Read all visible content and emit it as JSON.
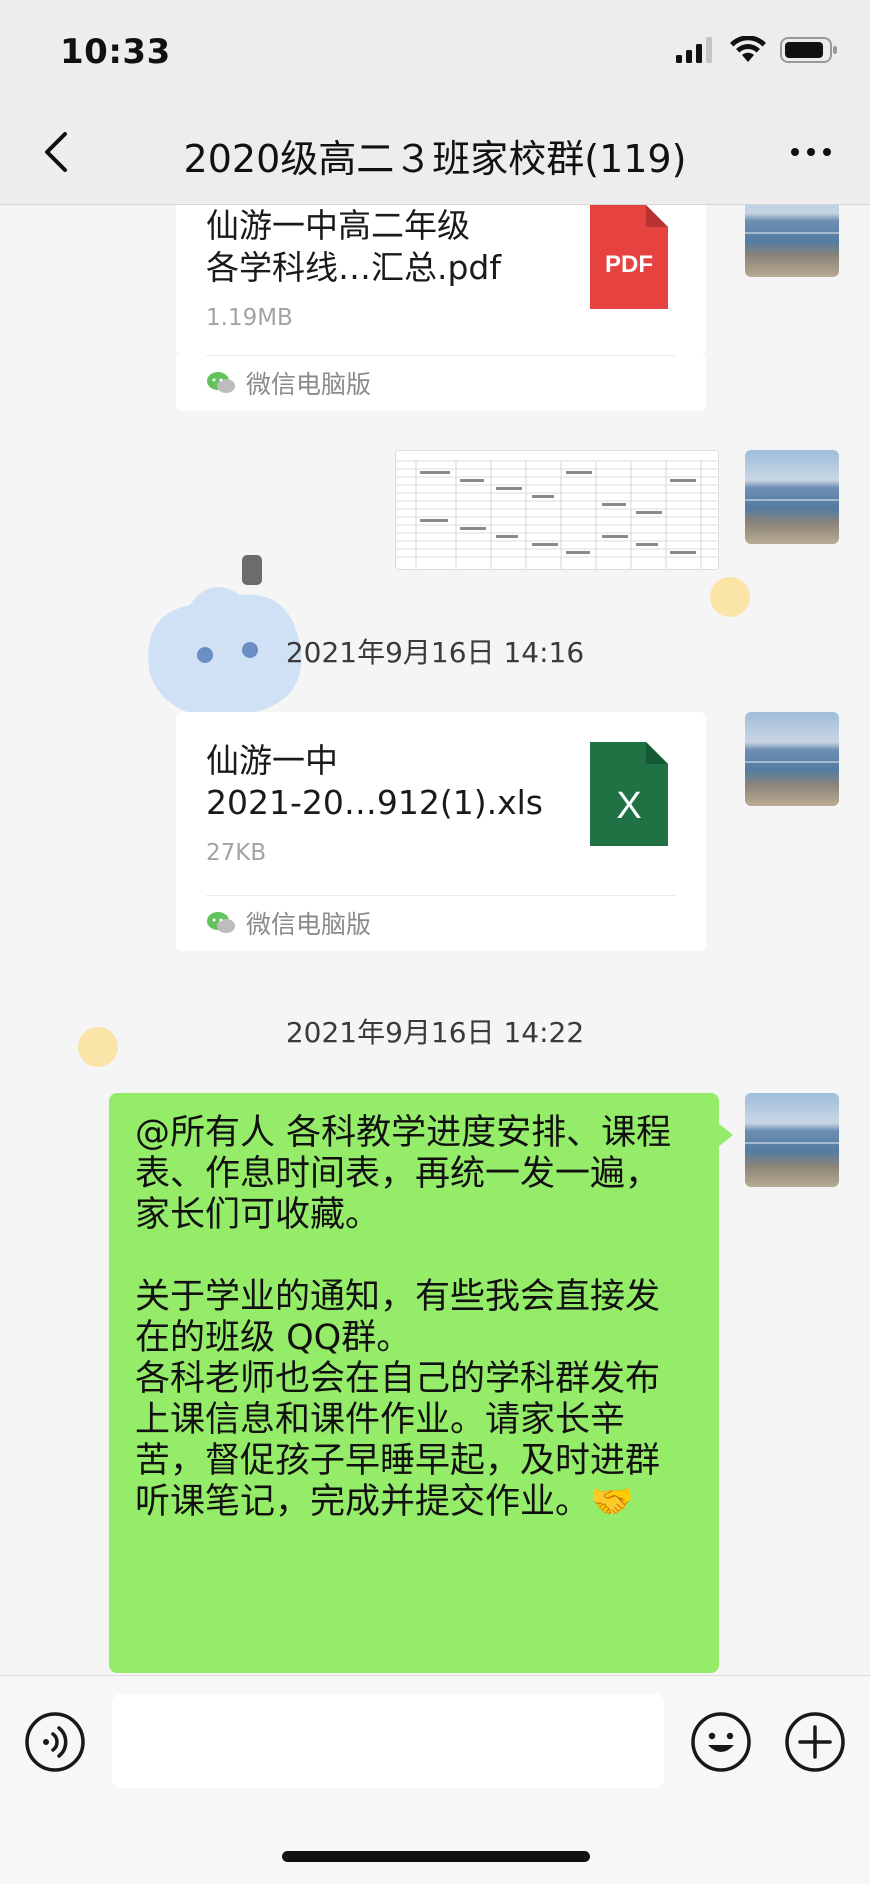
{
  "status_bar": {
    "time": "10:33"
  },
  "header": {
    "title": "2020级高二３班家校群(119)"
  },
  "messages": {
    "file1": {
      "name_line1": "仙游一中高二年级",
      "name_line2": "各学科线…汇总.pdf",
      "size": "1.19MB",
      "icon": "pdf-icon",
      "icon_label": "PDF",
      "source": "微信电脑版"
    },
    "image_msg": {
      "icon": "spreadsheet-thumbnail"
    },
    "timestamp1": "2021年9月16日 14:16",
    "file2": {
      "name_line1": "仙游一中",
      "name_line2": "2021-20…912(1).xls",
      "size": "27KB",
      "icon": "excel-icon",
      "icon_label": "X",
      "source": "微信电脑版"
    },
    "timestamp2": "2021年9月16日 14:22",
    "text_bubble": {
      "para1": "@所有人 各科教学进度安排、课程表、作息时间表，再统一发一遍，家长们可收藏。",
      "para2": "关于学业的通知，有些我会直接发在的班级 QQ群。",
      "para3": "各科老师也会在自己的学科群发布上课信息和课件作业。请家长辛苦，督促孩子早睡早起，及时进群听课笔记，完成并提交作业。🤝"
    }
  },
  "input_bar": {
    "value": "",
    "voice_icon": "voice-icon",
    "emoji_icon": "emoji-icon",
    "plus_icon": "plus-icon"
  },
  "colors": {
    "bubble_green": "#95ec69",
    "pdf_red": "#e64340",
    "excel_green": "#207245",
    "background": "#ededed"
  }
}
